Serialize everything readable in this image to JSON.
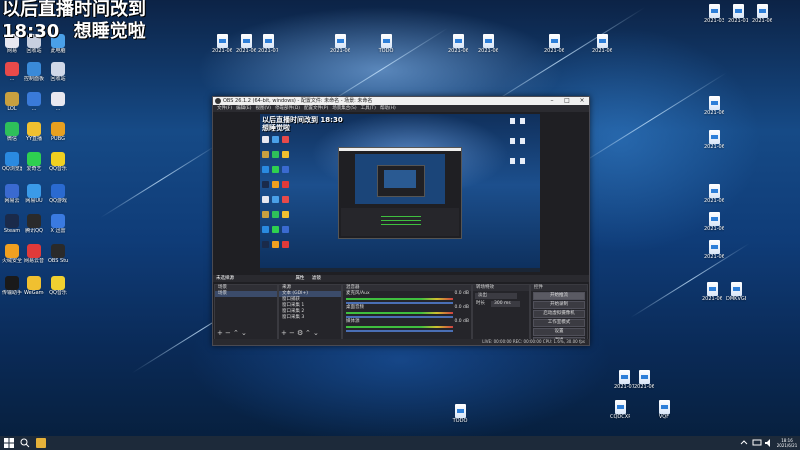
{
  "overlay": {
    "line1": "以后直播时间改到",
    "line2_time": "18:30",
    "line2_rest": "想睡觉啦"
  },
  "desktop_icons_left": [
    {
      "label": "网易",
      "color": "#e8e8f0"
    },
    {
      "label": "回收站",
      "color": "#c8d0e0"
    },
    {
      "label": "此电脑",
      "color": "#4aa0e8"
    },
    {
      "label": "...",
      "color": "#e84a4a"
    },
    {
      "label": "控制面板",
      "color": "#3a8ad8"
    },
    {
      "label": "回收站",
      "color": "#d0d8e8"
    },
    {
      "label": "LOL",
      "color": "#c8a040"
    },
    {
      "label": "...",
      "color": "#3a7ad8"
    },
    {
      "label": "...",
      "color": "#e8e8f0"
    },
    {
      "label": "微信",
      "color": "#2ec05a"
    },
    {
      "label": "YY直播",
      "color": "#f0c030"
    },
    {
      "label": "PUBG",
      "color": "#e8a020"
    },
    {
      "label": "QQ浏览器",
      "color": "#2a8ae0"
    },
    {
      "label": "爱奇艺",
      "color": "#2ed050"
    },
    {
      "label": "QQ音乐",
      "color": "#f0d020"
    },
    {
      "label": "网易云",
      "color": "#3a6ad0"
    },
    {
      "label": "网易UU",
      "color": "#3a9ae8"
    },
    {
      "label": "QQ游戏",
      "color": "#2a6ad0"
    },
    {
      "label": "Steam",
      "color": "#1a2a4a"
    },
    {
      "label": "腾讯QQ",
      "color": "#2a2a2a"
    },
    {
      "label": "X 迅雷",
      "color": "#3a7ae0"
    },
    {
      "label": "火绒安全",
      "color": "#f0a020"
    },
    {
      "label": "网易云音乐",
      "color": "#e03a3a"
    },
    {
      "label": "OBS Studio",
      "color": "#2a2a2a"
    },
    {
      "label": "传输助手",
      "color": "#1a1a1a"
    },
    {
      "label": "WeGame",
      "color": "#f0c030"
    },
    {
      "label": "QQ音乐",
      "color": "#f0d030"
    }
  ],
  "desktop_files_top": [
    {
      "label": "2021-06-14"
    },
    {
      "label": "2021-06-13"
    },
    {
      "label": "2021-07-02"
    },
    {
      "label": "2021-06-24"
    },
    {
      "label": "TODO"
    },
    {
      "label": "2021-06-25 FVAH"
    },
    {
      "label": "2021-06-23"
    },
    {
      "label": "2021-06-15"
    },
    {
      "label": "2021-06-22"
    }
  ],
  "desktop_files_right": [
    {
      "label": "2021-03-13"
    },
    {
      "label": "2021-01-15"
    },
    {
      "label": "2021-06-15"
    },
    {
      "label": "2021-06-18"
    },
    {
      "label": "2021-06-13"
    },
    {
      "label": "2021-06-15"
    },
    {
      "label": "2021-06-03"
    },
    {
      "label": "2021-06-07"
    },
    {
      "label": "2021-06-03"
    },
    {
      "label": "DMKVGB"
    }
  ],
  "desktop_files_bottom": [
    {
      "label": "2021-07-21"
    },
    {
      "label": "2021-06-19"
    },
    {
      "label": "CQDCXR..."
    },
    {
      "label": "VQF"
    },
    {
      "label": "TODO"
    }
  ],
  "obs": {
    "title": "OBS 26.1.2 (64-bit, windows) - 配置文件: 未命名 - 场景: 未命名",
    "menu": [
      "文件(F)",
      "编辑(E)",
      "视图(V)",
      "停靠部件(D)",
      "配置文件(P)",
      "场景集合(S)",
      "工具(T)",
      "帮助(H)"
    ],
    "preview_overlay": "以后直播时间改到 18:30 想睡觉啦",
    "tabs": [
      "未选择源",
      "属性",
      "滤镜"
    ],
    "docks": {
      "scenes": {
        "title": "场景",
        "items": [
          "场景"
        ]
      },
      "sources": {
        "title": "来源",
        "items": [
          "文本 (GDI+)",
          "窗口捕获",
          "窗口采集 1",
          "窗口采集 2",
          "窗口采集 3"
        ]
      },
      "mixer": {
        "title": "混音器",
        "channels": [
          {
            "name": "麦克风/Aux",
            "db": "0.0 dB"
          },
          {
            "name": "桌面音频",
            "db": "0.0 dB"
          },
          {
            "name": "媒体源",
            "db": "0.0 dB"
          }
        ]
      },
      "transitions": {
        "title": "转场特效",
        "type": "淡出",
        "duration_label": "时长",
        "duration": "300 ms"
      },
      "controls": {
        "title": "控件",
        "buttons": [
          "开始推流",
          "开始录制",
          "启动虚拟摄像机",
          "工作室模式",
          "设置",
          "退出"
        ]
      }
    },
    "status": "LIVE: 00:00:00   REC: 00:00:00   CPU: 1.6%, 30.00 fps"
  },
  "taskbar": {
    "time": "18:16",
    "date": "2021/6/21"
  }
}
